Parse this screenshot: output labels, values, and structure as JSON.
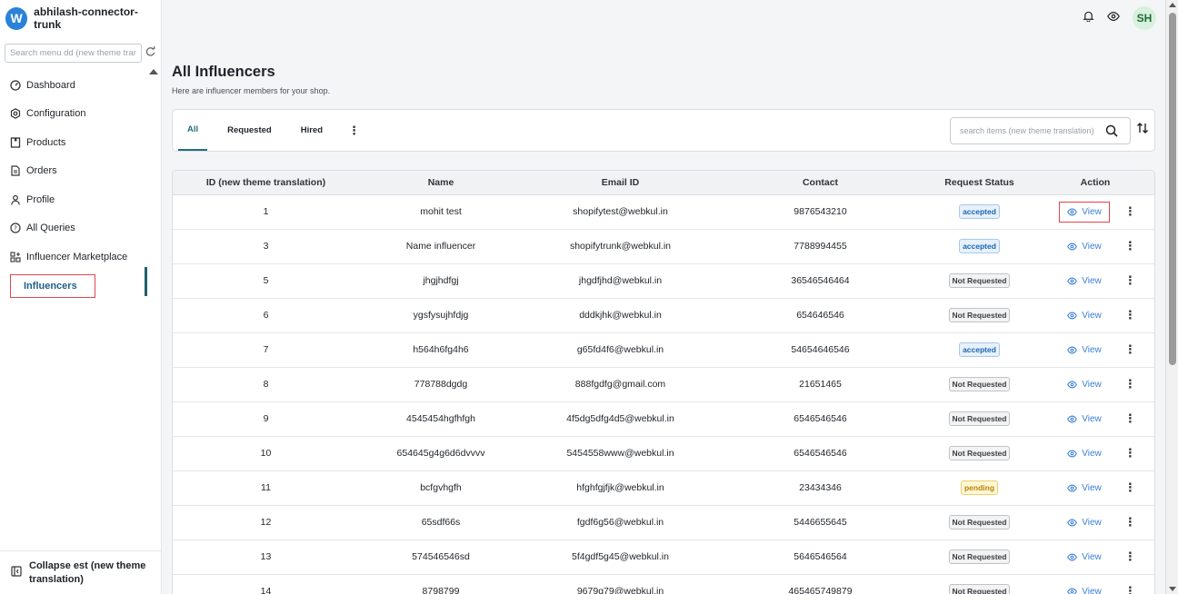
{
  "app": {
    "brand_initial": "W",
    "brand_name": "abhilash-connector-trunk",
    "avatar": "SH"
  },
  "sidebar": {
    "search_placeholder": "Search menu dd (new theme translation)",
    "items": [
      {
        "label": "Dashboard",
        "icon": "gauge-icon"
      },
      {
        "label": "Configuration",
        "icon": "settings-icon"
      },
      {
        "label": "Products",
        "icon": "book-icon"
      },
      {
        "label": "Orders",
        "icon": "document-icon"
      },
      {
        "label": "Profile",
        "icon": "user-icon"
      },
      {
        "label": "All Queries",
        "icon": "help-icon"
      },
      {
        "label": "Influencer Marketplace",
        "icon": "apps-icon"
      },
      {
        "label": "Influencers",
        "icon": "",
        "active": true
      }
    ],
    "collapse_label": "Collapse est (new theme translation)"
  },
  "page": {
    "title": "All Influencers",
    "subtitle": "Here are influencer members for your shop."
  },
  "tabs": {
    "all": "All",
    "requested": "Requested",
    "hired": "Hired"
  },
  "item_search": {
    "placeholder": "search items (new theme translation)"
  },
  "table": {
    "headers": [
      "ID (new theme translation)",
      "Name",
      "Email ID",
      "Contact",
      "Request Status",
      "Action"
    ],
    "view_label": "View",
    "rows": [
      {
        "id": "1",
        "name": "mohit test",
        "email": "shopifytest@webkul.in",
        "contact": "9876543210",
        "status": "accepted"
      },
      {
        "id": "3",
        "name": "Name influencer",
        "email": "shopifytrunk@webkul.in",
        "contact": "7788994455",
        "status": "accepted"
      },
      {
        "id": "5",
        "name": "jhgjhdfgj",
        "email": "jhgdfjhd@webkul.in",
        "contact": "36546546464",
        "status": "Not Requested"
      },
      {
        "id": "6",
        "name": "ygsfysujhfdjg",
        "email": "dddkjhk@webkul.in",
        "contact": "654646546",
        "status": "Not Requested"
      },
      {
        "id": "7",
        "name": "h564h6fg4h6",
        "email": "g65fd4f6@webkul.in",
        "contact": "54654646546",
        "status": "accepted"
      },
      {
        "id": "8",
        "name": "778788dgdg",
        "email": "888fgdfg@gmail.com",
        "contact": "21651465",
        "status": "Not Requested"
      },
      {
        "id": "9",
        "name": "4545454hgfhfgh",
        "email": "4f5dg5dfg4d5@webkul.in",
        "contact": "6546546546",
        "status": "Not Requested"
      },
      {
        "id": "10",
        "name": "654645g4g6d6dvvvv",
        "email": "5454558www@webkul.in",
        "contact": "6546546546",
        "status": "Not Requested"
      },
      {
        "id": "11",
        "name": "bcfgvhgfh",
        "email": "hfghfgjfjk@webkul.in",
        "contact": "23434346",
        "status": "pending"
      },
      {
        "id": "12",
        "name": "65sdf66s",
        "email": "fgdf6g56@webkul.in",
        "contact": "5446655645",
        "status": "Not Requested"
      },
      {
        "id": "13",
        "name": "574546546sd",
        "email": "5f4gdf5g45@webkul.in",
        "contact": "5646546564",
        "status": "Not Requested"
      },
      {
        "id": "14",
        "name": "8798799",
        "email": "9679g79@webkul.in",
        "contact": "465465749879",
        "status": "Not Requested"
      }
    ]
  },
  "colors": {
    "accent": "#1f6f7a",
    "link": "#3a7fd4",
    "highlight": "#e0454d"
  }
}
